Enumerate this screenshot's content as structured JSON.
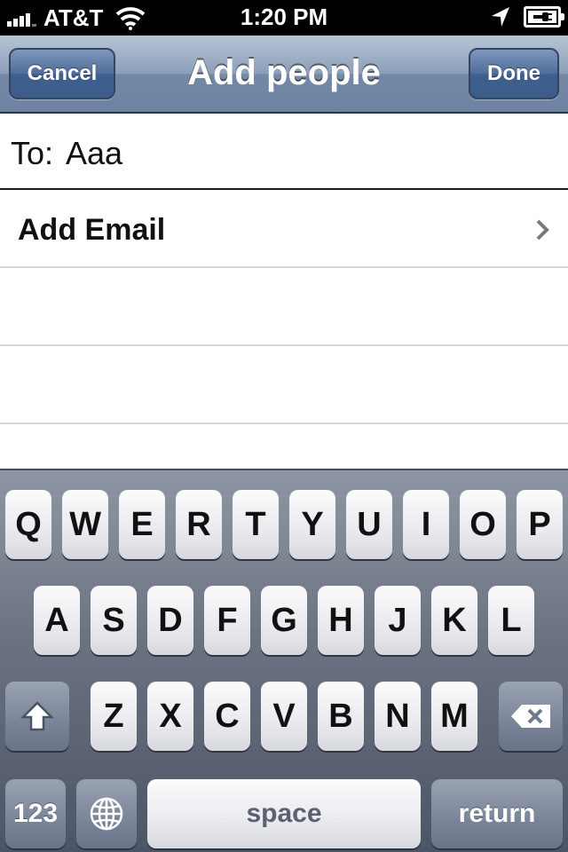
{
  "status_bar": {
    "carrier": "AT&T",
    "time": "1:20 PM",
    "icons": [
      "signal-icon",
      "wifi-icon",
      "location-icon",
      "battery-charging-icon"
    ]
  },
  "nav": {
    "title": "Add people",
    "cancel_label": "Cancel",
    "done_label": "Done"
  },
  "to_field": {
    "label": "To:",
    "value": "Aaa"
  },
  "list": {
    "add_email_label": "Add Email"
  },
  "keyboard": {
    "row1": [
      "Q",
      "W",
      "E",
      "R",
      "T",
      "Y",
      "U",
      "I",
      "O",
      "P"
    ],
    "row2": [
      "A",
      "S",
      "D",
      "F",
      "G",
      "H",
      "J",
      "K",
      "L"
    ],
    "row3": [
      "Z",
      "X",
      "C",
      "V",
      "B",
      "N",
      "M"
    ],
    "numbers_label": "123",
    "space_label": "space",
    "return_label": "return",
    "icons": [
      "shift-icon",
      "backspace-icon",
      "globe-icon"
    ]
  },
  "colors": {
    "nav_bar": "#8b9fb9",
    "nav_button": "#4f6d99",
    "keyboard_bg": "#6a7282"
  }
}
